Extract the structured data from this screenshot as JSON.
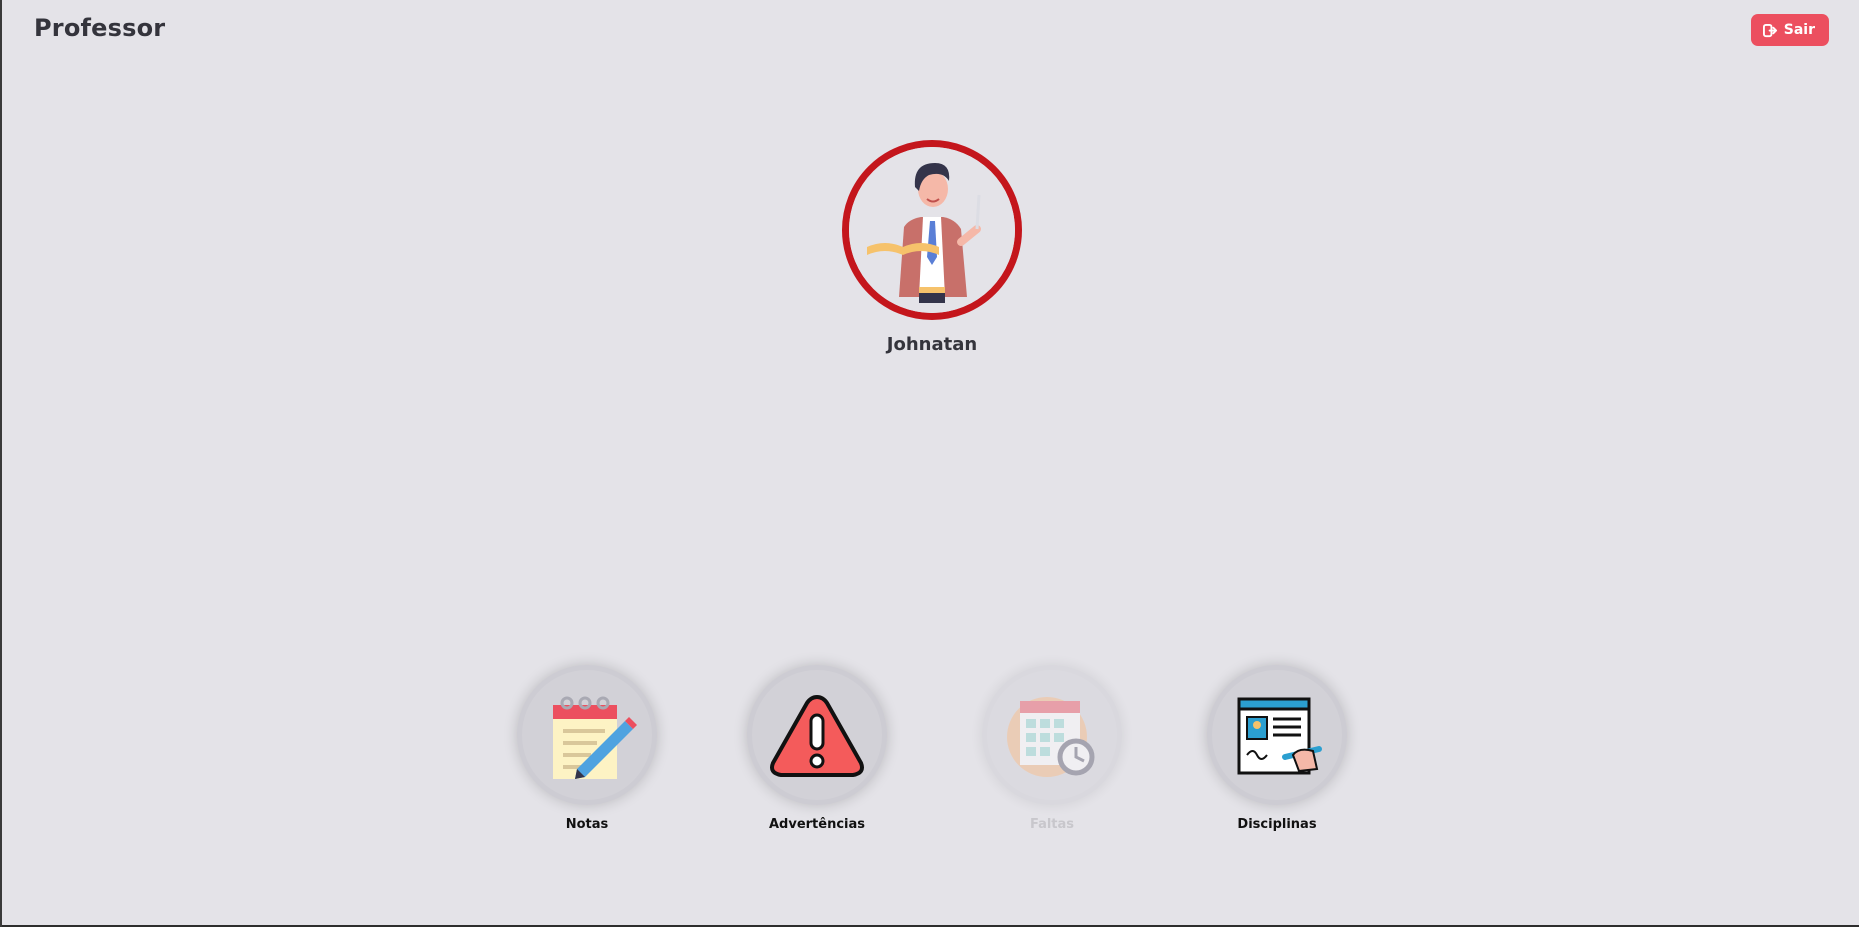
{
  "header": {
    "title": "Professor",
    "logout_label": "Sair"
  },
  "profile": {
    "name": "Johnatan"
  },
  "menu": [
    {
      "label": "Notas",
      "icon": "notepad-pencil-icon",
      "enabled": true
    },
    {
      "label": "Advertências",
      "icon": "warning-triangle-icon",
      "enabled": true
    },
    {
      "label": "Faltas",
      "icon": "calendar-clock-icon",
      "enabled": false
    },
    {
      "label": "Disciplinas",
      "icon": "document-signature-icon",
      "enabled": true
    }
  ],
  "colors": {
    "accent": "#c4161c",
    "logout_button": "#ec4f5f",
    "background": "#e4e3e8"
  }
}
